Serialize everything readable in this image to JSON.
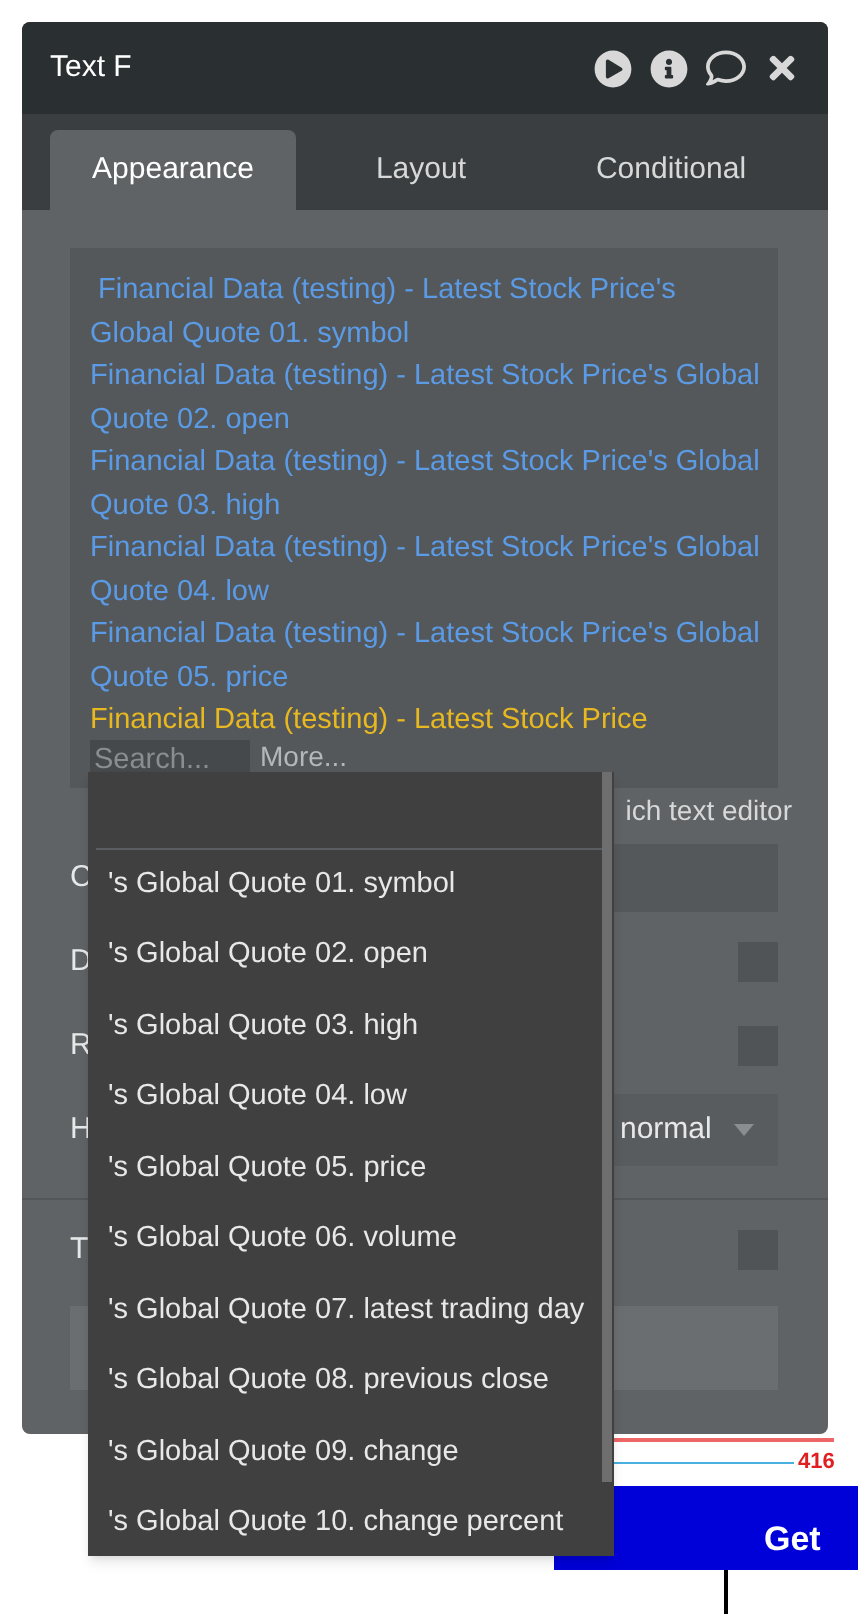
{
  "window": {
    "title": "Text F"
  },
  "tabs": [
    {
      "label": "Appearance",
      "selected": true
    },
    {
      "label": "Layout",
      "selected": false
    },
    {
      "label": "Conditional",
      "selected": false
    }
  ],
  "editor": {
    "lines": [
      {
        "text": " Financial Data (testing) - Latest Stock Price's Global Quote 01. symbol",
        "kind": "expression"
      },
      {
        "text": "Financial Data (testing) - Latest Stock Price's Global Quote 02. open",
        "kind": "expression"
      },
      {
        "text": "Financial Data (testing) - Latest Stock Price's Global Quote 03. high",
        "kind": "expression"
      },
      {
        "text": "Financial Data (testing) - Latest Stock Price's Global Quote 04. low",
        "kind": "expression"
      },
      {
        "text": "Financial Data (testing) - Latest Stock Price's Global Quote 05. price",
        "kind": "expression"
      },
      {
        "text": "Financial Data (testing) - Latest Stock Price",
        "kind": "pending"
      }
    ],
    "search": {
      "placeholder": "Search..."
    },
    "more": "More..."
  },
  "hint": "ich text editor",
  "rows": [
    {
      "label": "C",
      "kind": "input"
    },
    {
      "label": "D",
      "kind": "checkbox",
      "checked": false
    },
    {
      "label": "R",
      "kind": "checkbox",
      "checked": false
    },
    {
      "label": "H",
      "kind": "select",
      "value": "normal"
    },
    {
      "label": "T",
      "kind": "checkbox",
      "checked": false
    }
  ],
  "dropdown": [
    "'s Global Quote 01. symbol",
    "'s Global Quote 02. open",
    "'s Global Quote 03. high",
    "'s Global Quote 04. low",
    "'s Global Quote 05. price",
    "'s Global Quote 06. volume",
    "'s Global Quote 07. latest trading day",
    "'s Global Quote 08. previous close",
    "'s Global Quote 09. change",
    "'s Global Quote 10. change percent"
  ],
  "background": {
    "number": "416",
    "button": "Get"
  }
}
